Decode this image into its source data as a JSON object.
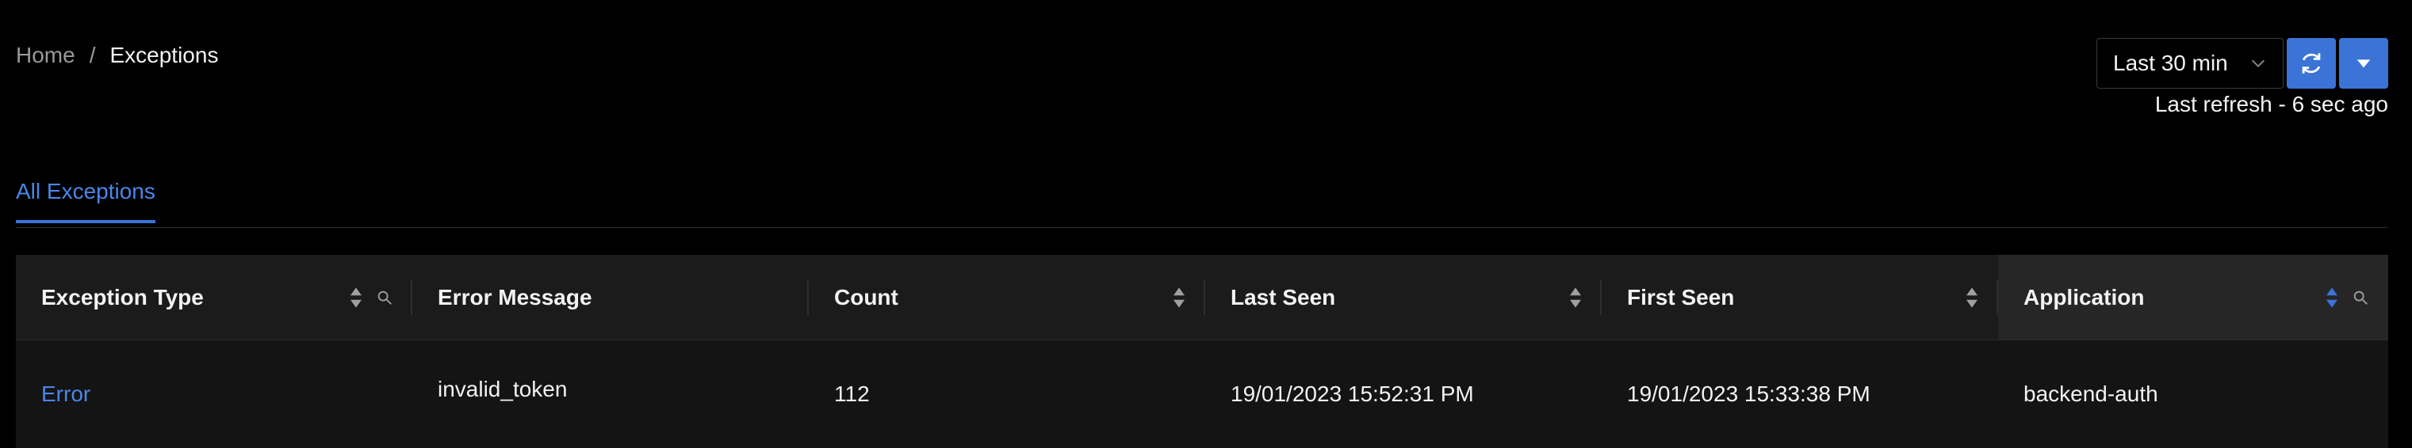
{
  "breadcrumb": {
    "home": "Home",
    "separator": "/",
    "current": "Exceptions"
  },
  "time_controls": {
    "range_label": "Last 30 min",
    "last_refresh": "Last refresh - 6 sec ago"
  },
  "tabs": [
    {
      "label": "All Exceptions",
      "active": true
    }
  ],
  "table": {
    "columns": [
      {
        "label": "Exception Type"
      },
      {
        "label": "Error Message"
      },
      {
        "label": "Count"
      },
      {
        "label": "Last Seen"
      },
      {
        "label": "First Seen"
      },
      {
        "label": "Application"
      }
    ],
    "rows": [
      {
        "exception_type": "Error",
        "error_message": "invalid_token",
        "count": "112",
        "last_seen": "19/01/2023 15:52:31 PM",
        "first_seen": "19/01/2023 15:33:38 PM",
        "application": "backend-auth"
      }
    ]
  },
  "colors": {
    "background": "#000000",
    "accent": "#3b73d6",
    "link": "#4a86e8",
    "header_bg": "#1b1b1b",
    "row_bg": "#141414"
  }
}
